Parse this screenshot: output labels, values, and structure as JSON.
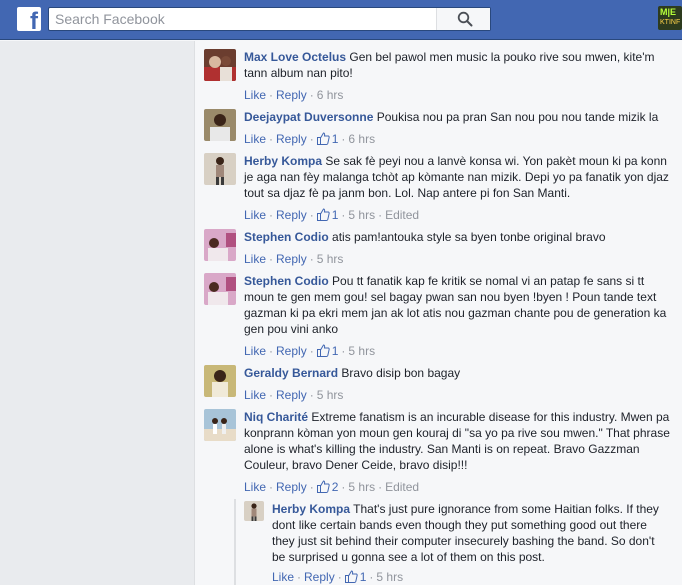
{
  "header": {
    "search_placeholder": "Search Facebook",
    "logo_letter": "f",
    "corner_top": "M|E",
    "corner_bottom": "KTINF"
  },
  "actions": {
    "like": "Like",
    "reply": "Reply",
    "separator": "·"
  },
  "comments": [
    {
      "author": "Max Love Octelus",
      "text": "Gen bel pawol men music la pouko rive sou mwen, kite'm tann album nan pito!",
      "likes": "",
      "time": "6 hrs",
      "edited": ""
    },
    {
      "author": "Deejaypat Duversonne",
      "text": "Poukisa nou pa pran San nou pou nou tande mizik la",
      "likes": "1",
      "time": "6 hrs",
      "edited": ""
    },
    {
      "author": "Herby Kompa",
      "text": "Se sak fè peyi nou a lanvè konsa wi. Yon pakèt moun ki pa konn je aga nan fèy malanga tchòt ap kòmante nan mizik. Depi yo pa fanatik yon djaz tout sa djaz fè pa janm bon. Lol. Nap antere pi fon San Manti.",
      "likes": "1",
      "time": "5 hrs",
      "edited": "Edited"
    },
    {
      "author": "Stephen Codio",
      "text": "atis pam!antouka style sa byen tonbe original bravo",
      "likes": "",
      "time": "5 hrs",
      "edited": ""
    },
    {
      "author": "Stephen Codio",
      "text": "Pou tt fanatik kap fe kritik se nomal vi an patap fe sans si tt moun te gen mem gou! sel bagay pwan san nou byen !byen ! Poun tande text gazman ki pa ekri mem jan ak lot atis nou gazman chante pou de generation ka gen pou vini anko",
      "likes": "1",
      "time": "5 hrs",
      "edited": ""
    },
    {
      "author": "Geraldy Bernard",
      "text": "Bravo disip bon bagay",
      "likes": "",
      "time": "5 hrs",
      "edited": ""
    },
    {
      "author": "Niq Charité",
      "text": "Extreme fanatism is an incurable disease for this industry. Mwen pa konprann kòman yon moun gen kouraj di \"sa yo pa rive sou mwen.\" That phrase alone is what's killing the industry. San Manti is on repeat. Bravo Gazzman Couleur, bravo Dener Ceide, bravo disip!!!",
      "likes": "2",
      "time": "5 hrs",
      "edited": "Edited"
    }
  ],
  "reply": {
    "author": "Herby Kompa",
    "text": "That's just pure ignorance from some Haitian folks. If they dont like certain bands even though they put something good out there they just sit behind their computer insecurely bashing the band. So don't be surprised u gonna see a lot of them on this post.",
    "likes": "1",
    "time": "5 hrs",
    "edited": ""
  }
}
